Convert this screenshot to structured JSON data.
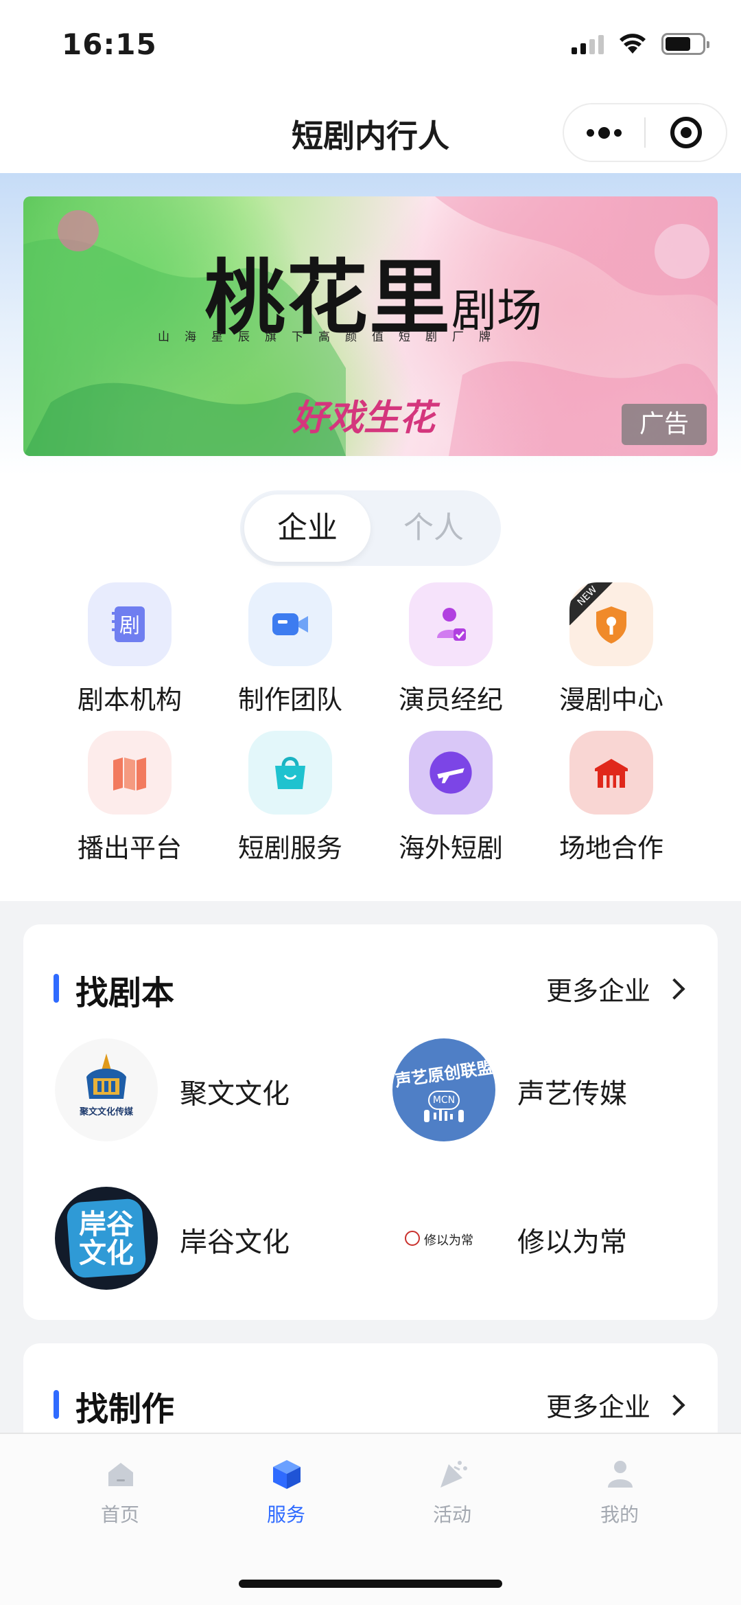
{
  "status_bar": {
    "time": "16:15"
  },
  "nav": {
    "title": "短剧内行人",
    "more_icon": "more-dots-icon",
    "close_icon": "target-circle-icon"
  },
  "banner": {
    "title_main": "桃花里",
    "title_small": "剧场",
    "subtitle": "山海星辰旗下高颜值短剧厂牌",
    "brand": "好戏生花",
    "ad_label": "广告"
  },
  "segment": {
    "tabs": [
      {
        "label": "企业",
        "active": true
      },
      {
        "label": "个人",
        "active": false
      }
    ]
  },
  "services": [
    {
      "label": "剧本机构",
      "icon": "script-icon",
      "bg": "#e8ecfd"
    },
    {
      "label": "制作团队",
      "icon": "video-camera-icon",
      "bg": "#e8f1fd"
    },
    {
      "label": "演员经纪",
      "icon": "actor-icon",
      "bg": "#f6e3fb"
    },
    {
      "label": "漫剧中心",
      "icon": "shield-key-icon",
      "bg": "#fdeee3",
      "badge": "NEW"
    },
    {
      "label": "播出平台",
      "icon": "broadcast-map-icon",
      "bg": "#fdeceb"
    },
    {
      "label": "短剧服务",
      "icon": "shopping-bag-icon",
      "bg": "#e3f7fa"
    },
    {
      "label": "海外短剧",
      "icon": "airplane-icon",
      "bg": "#d9c7f7"
    },
    {
      "label": "场地合作",
      "icon": "venue-icon",
      "bg": "#f9d6d3"
    }
  ],
  "script_card": {
    "title": "找剧本",
    "more": "更多企业",
    "companies": [
      {
        "name": "聚文文化",
        "logo_text": "聚文文化传媒",
        "logo": "juwen-logo"
      },
      {
        "name": "声艺传媒",
        "logo_text": "声艺原创联盟",
        "logo_sub": "MCN",
        "logo": "shengyi-logo"
      },
      {
        "name": "岸谷文化",
        "logo_text": "岸谷文化",
        "logo": "angu-logo"
      },
      {
        "name": "修以为常",
        "logo_text": "修以为常",
        "logo": "xiuyiweichang-logo"
      }
    ]
  },
  "production_card": {
    "title": "找制作",
    "more": "更多企业"
  },
  "tabbar": {
    "tabs": [
      {
        "label": "首页",
        "icon": "home-icon",
        "active": false
      },
      {
        "label": "服务",
        "icon": "service-box-icon",
        "active": true
      },
      {
        "label": "活动",
        "icon": "party-popper-icon",
        "active": false
      },
      {
        "label": "我的",
        "icon": "user-icon",
        "active": false
      }
    ]
  },
  "colors": {
    "accent": "#2f6bff",
    "inactive_tab": "#a4a9b1"
  }
}
